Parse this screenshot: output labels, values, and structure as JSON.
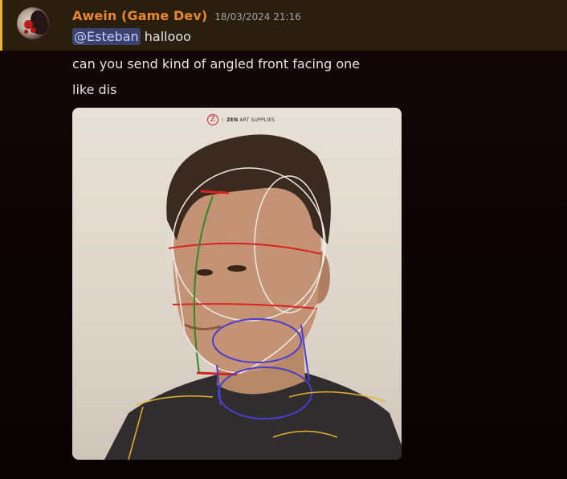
{
  "message": {
    "username": "Awein (Game Dev)",
    "timestamp": "18/03/2024 21:16",
    "mention": "@Esteban",
    "first_line_text": "hallooo",
    "lines": [
      "can you send kind of angled front facing one",
      "like dis"
    ]
  },
  "attachment": {
    "brand_name": "ZEN",
    "brand_suffix": "ART SUPPLIES",
    "logo_letter": "Z"
  },
  "colors": {
    "username": "#e9862f",
    "highlight_bg": "#2a1e0e",
    "highlight_bar": "#f0b232",
    "mention_bg": "#3c4270",
    "background": "#0c0505"
  }
}
